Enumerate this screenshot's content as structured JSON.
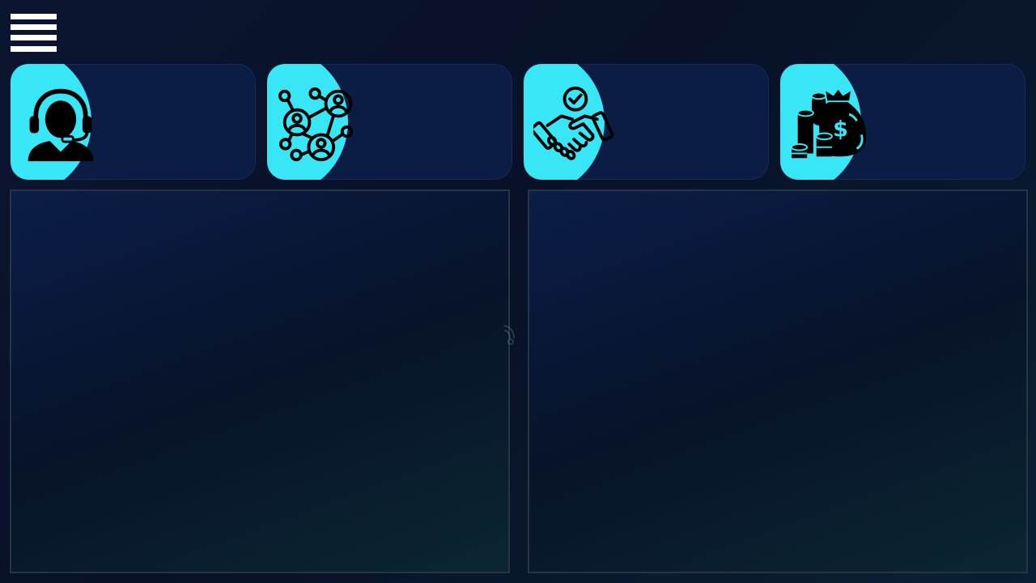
{
  "menu": {
    "icon": "hamburger-menu-icon"
  },
  "cards": [
    {
      "icon": "customer-support-headset-icon",
      "label": ""
    },
    {
      "icon": "network-people-icon",
      "label": ""
    },
    {
      "icon": "handshake-agreement-icon",
      "label": ""
    },
    {
      "icon": "money-bag-coins-icon",
      "label": ""
    }
  ],
  "panels": [
    {
      "title": ""
    },
    {
      "title": ""
    }
  ],
  "colors": {
    "background": "#081127",
    "card": "#0c1d45",
    "accent": "#38e6f5",
    "panel_border": "#283846"
  }
}
